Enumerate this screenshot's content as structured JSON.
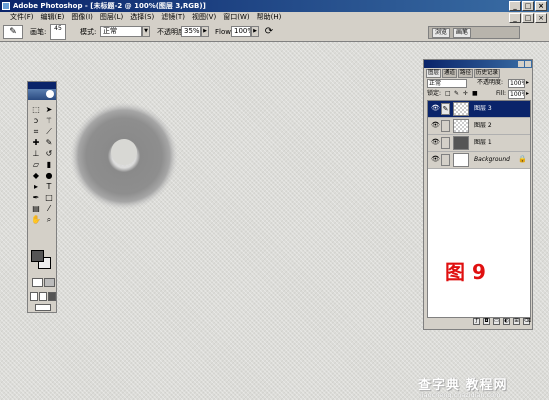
{
  "window": {
    "title": "Adobe Photoshop - [未标题-2 @ 100%(图层 3,RGB)]",
    "controls": [
      "_",
      "□",
      "×"
    ]
  },
  "menubar": {
    "items": [
      "文件(F)",
      "编辑(E)",
      "图像(I)",
      "图层(L)",
      "选择(S)",
      "滤镜(T)",
      "视图(V)",
      "窗口(W)",
      "帮助(H)"
    ],
    "doc_controls": [
      "_",
      "□",
      "×"
    ]
  },
  "options_bar": {
    "brush_label": "画笔:",
    "brush_size": "45",
    "mode_label": "模式:",
    "mode_value": "正常",
    "opacity_label": "不透明度:",
    "opacity_value": "35%",
    "flow_label": "Flow:",
    "flow_value": "100%"
  },
  "palette_well": {
    "tabs": [
      "浏览",
      "画笔"
    ]
  },
  "layers_panel": {
    "tabs": [
      "图层",
      "通道",
      "路径",
      "历史记录"
    ],
    "blend_mode": "正常",
    "opacity_label": "不透明度:",
    "opacity_value": "100%",
    "lock_label": "锁定:",
    "fill_label": "Fill:",
    "fill_value": "100%",
    "layers": [
      {
        "name": "图层 3",
        "selected": true
      },
      {
        "name": "图层 2",
        "selected": false
      },
      {
        "name": "图层 1",
        "selected": false
      },
      {
        "name": "Background",
        "selected": false
      }
    ]
  },
  "annotation": {
    "text": "图 9",
    "color": "#e01010"
  },
  "watermark": {
    "main": "查字典 教程网",
    "url": "jiaocheng.chazidian.com"
  },
  "colors": {
    "title_bar": "#0a246a",
    "chrome": "#d4d0c8",
    "selected_layer": "#0a246a",
    "brush_stroke": "#8c8c8c"
  }
}
